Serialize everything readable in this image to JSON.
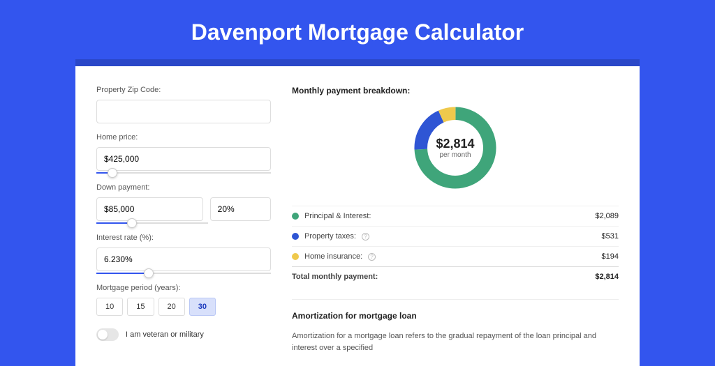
{
  "page_title": "Davenport Mortgage Calculator",
  "form": {
    "zip_label": "Property Zip Code:",
    "zip_value": "",
    "home_price_label": "Home price:",
    "home_price_value": "$425,000",
    "home_price_slider_pct": 9,
    "down_payment_label": "Down payment:",
    "down_payment_value": "$85,000",
    "down_payment_pct_value": "20%",
    "down_payment_slider_pct": 20,
    "interest_label": "Interest rate (%):",
    "interest_value": "6.230%",
    "interest_slider_pct": 30,
    "period_label": "Mortgage period (years):",
    "period_options": [
      "10",
      "15",
      "20",
      "30"
    ],
    "period_selected": "30",
    "veteran_label": "I am veteran or military"
  },
  "breakdown": {
    "title": "Monthly payment breakdown:",
    "center_amount": "$2,814",
    "center_sub": "per month",
    "items": [
      {
        "label": "Principal & Interest:",
        "value": "$2,089",
        "color": "#3fa57a",
        "info": false
      },
      {
        "label": "Property taxes:",
        "value": "$531",
        "color": "#2f55d4",
        "info": true
      },
      {
        "label": "Home insurance:",
        "value": "$194",
        "color": "#efc94c",
        "info": true
      }
    ],
    "total_label": "Total monthly payment:",
    "total_value": "$2,814"
  },
  "amortization": {
    "title": "Amortization for mortgage loan",
    "body": "Amortization for a mortgage loan refers to the gradual repayment of the loan principal and interest over a specified"
  },
  "chart_data": {
    "type": "pie",
    "title": "Monthly payment breakdown",
    "series": [
      {
        "name": "Principal & Interest",
        "value": 2089,
        "color": "#3fa57a"
      },
      {
        "name": "Property taxes",
        "value": 531,
        "color": "#2f55d4"
      },
      {
        "name": "Home insurance",
        "value": 194,
        "color": "#efc94c"
      }
    ],
    "total": 2814,
    "center_label": "$2,814 per month"
  }
}
